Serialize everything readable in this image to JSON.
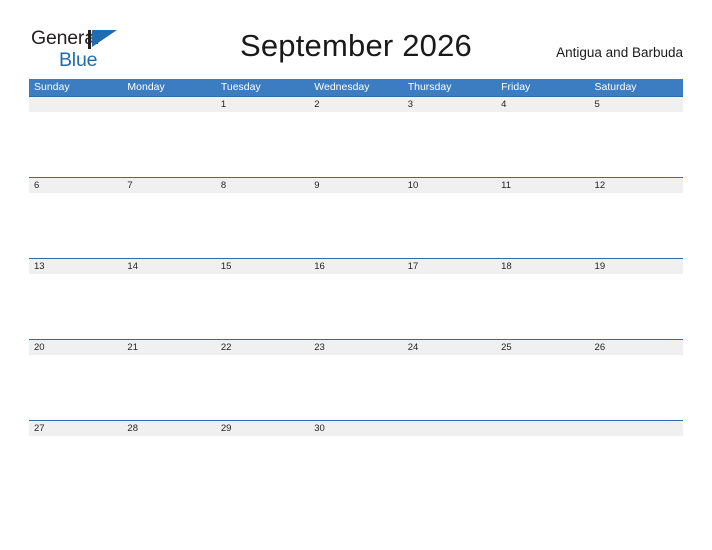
{
  "brand": {
    "name_part_one": "General",
    "name_part_two": "Blue",
    "flag_icon": "blue-triangle-flag-icon",
    "color_dark": "#231f20",
    "color_blue": "#1f6cb0"
  },
  "header": {
    "month_title": "September 2026",
    "locale": "Antigua and Barbuda"
  },
  "theme": {
    "header_blue": "#3b7dc0",
    "row_band_gray": "#f0f0f0",
    "row_border_blue": "#2f6ca8",
    "page_background": "#ffffff",
    "text_dark": "#232323"
  },
  "calendar": {
    "weekdays": [
      "Sunday",
      "Monday",
      "Tuesday",
      "Wednesday",
      "Thursday",
      "Friday",
      "Saturday"
    ],
    "weeks": [
      [
        "",
        "",
        "1",
        "2",
        "3",
        "4",
        "5"
      ],
      [
        "6",
        "7",
        "8",
        "9",
        "10",
        "11",
        "12"
      ],
      [
        "13",
        "14",
        "15",
        "16",
        "17",
        "18",
        "19"
      ],
      [
        "20",
        "21",
        "22",
        "23",
        "24",
        "25",
        "26"
      ],
      [
        "27",
        "28",
        "29",
        "30",
        "",
        "",
        ""
      ]
    ]
  }
}
